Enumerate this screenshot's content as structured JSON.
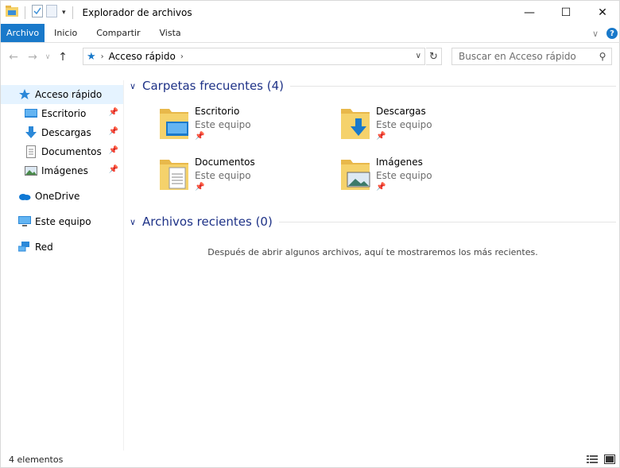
{
  "window": {
    "title": "Explorador de archivos",
    "controls": {
      "minimize": "—",
      "maximize": "☐",
      "close": "✕"
    }
  },
  "ribbon": {
    "tabs": [
      {
        "label": "Archivo",
        "active": true
      },
      {
        "label": "Inicio"
      },
      {
        "label": "Compartir"
      },
      {
        "label": "Vista"
      }
    ],
    "help": "?"
  },
  "address": {
    "breadcrumb": "Acceso rápido",
    "search_placeholder": "Buscar en Acceso rápido"
  },
  "sidebar": {
    "items": [
      {
        "label": "Acceso rápido",
        "icon": "star-icon",
        "selected": true
      },
      {
        "label": "Escritorio",
        "icon": "desktop-icon",
        "pinned": true
      },
      {
        "label": "Descargas",
        "icon": "download-icon",
        "pinned": true
      },
      {
        "label": "Documentos",
        "icon": "documents-icon",
        "pinned": true
      },
      {
        "label": "Imágenes",
        "icon": "pictures-icon",
        "pinned": true
      },
      {
        "label": "OneDrive",
        "icon": "cloud-icon"
      },
      {
        "label": "Este equipo",
        "icon": "computer-icon"
      },
      {
        "label": "Red",
        "icon": "network-icon"
      }
    ]
  },
  "content": {
    "frequent_header": "Carpetas frecuentes (4)",
    "folders": [
      {
        "name": "Escritorio",
        "location": "Este equipo",
        "icon": "desktop-folder-icon"
      },
      {
        "name": "Descargas",
        "location": "Este equipo",
        "icon": "downloads-folder-icon"
      },
      {
        "name": "Documentos",
        "location": "Este equipo",
        "icon": "documents-folder-icon"
      },
      {
        "name": "Imágenes",
        "location": "Este equipo",
        "icon": "pictures-folder-icon"
      }
    ],
    "recent_header": "Archivos recientes (0)",
    "empty_message": "Después de abrir algunos archivos, aquí te mostraremos los más recientes."
  },
  "status": {
    "count": "4 elementos"
  },
  "colors": {
    "accent": "#1979ca",
    "group_header": "#1e3287",
    "selection": "#e5f3ff",
    "folder": "#f5d26b"
  }
}
